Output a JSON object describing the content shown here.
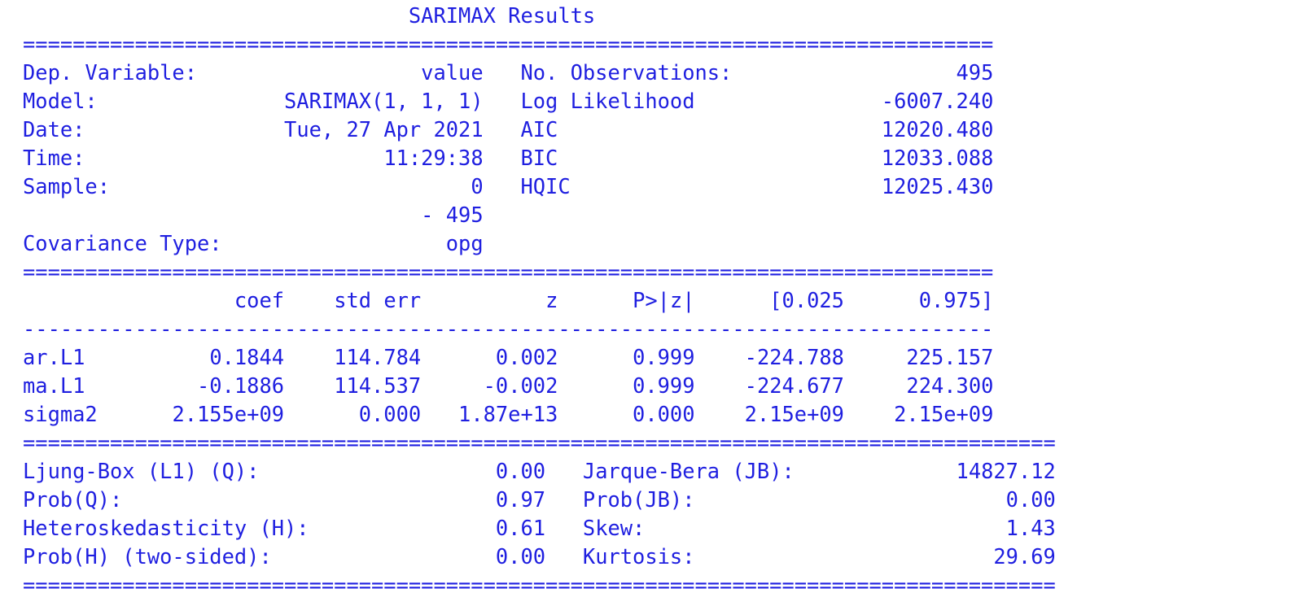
{
  "title": "SARIMAX Results",
  "header_left": [
    {
      "label": "Dep. Variable:",
      "value": "value"
    },
    {
      "label": "Model:",
      "value": "SARIMAX(1, 1, 1)"
    },
    {
      "label": "Date:",
      "value": "Tue, 27 Apr 2021"
    },
    {
      "label": "Time:",
      "value": "11:29:38"
    },
    {
      "label": "Sample:",
      "value": "0"
    },
    {
      "label": "",
      "value": "- 495"
    },
    {
      "label": "Covariance Type:",
      "value": "opg"
    }
  ],
  "header_right": [
    {
      "label": "No. Observations:",
      "value": "495"
    },
    {
      "label": "Log Likelihood",
      "value": "-6007.240"
    },
    {
      "label": "AIC",
      "value": "12020.480"
    },
    {
      "label": "BIC",
      "value": "12033.088"
    },
    {
      "label": "HQIC",
      "value": "12025.430"
    }
  ],
  "coef_columns": [
    "coef",
    "std err",
    "z",
    "P>|z|",
    "[0.025",
    "0.975]"
  ],
  "coef_rows": [
    {
      "name": "ar.L1",
      "values": [
        "0.1844",
        "114.784",
        "0.002",
        "0.999",
        "-224.788",
        "225.157"
      ]
    },
    {
      "name": "ma.L1",
      "values": [
        "-0.1886",
        "114.537",
        "-0.002",
        "0.999",
        "-224.677",
        "224.300"
      ]
    },
    {
      "name": "sigma2",
      "values": [
        "2.155e+09",
        "0.000",
        "1.87e+13",
        "0.000",
        "2.15e+09",
        "2.15e+09"
      ]
    }
  ],
  "diag_left": [
    {
      "label": "Ljung-Box (L1) (Q):",
      "value": "0.00"
    },
    {
      "label": "Prob(Q):",
      "value": "0.97"
    },
    {
      "label": "Heteroskedasticity (H):",
      "value": "0.61"
    },
    {
      "label": "Prob(H) (two-sided):",
      "value": "0.00"
    }
  ],
  "diag_right": [
    {
      "label": "Jarque-Bera (JB):",
      "value": "14827.12"
    },
    {
      "label": "Prob(JB):",
      "value": "0.00"
    },
    {
      "label": "Skew:",
      "value": "1.43"
    },
    {
      "label": "Kurtosis:",
      "value": "29.69"
    }
  ]
}
